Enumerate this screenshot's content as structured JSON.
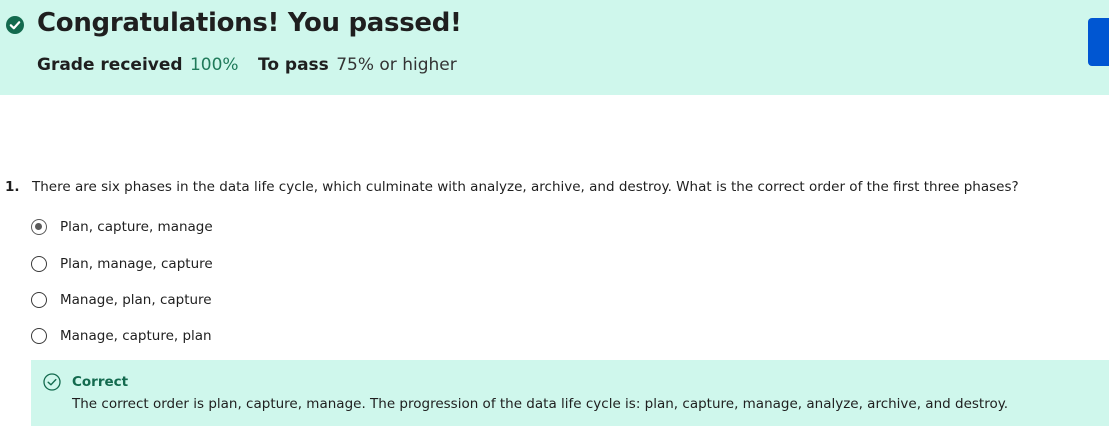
{
  "banner": {
    "title": "Congratulations! You passed!",
    "grade_label": "Grade received",
    "grade_value": "100%",
    "pass_label": "To pass",
    "pass_value": "75% or higher",
    "background_color": "#cff7ec",
    "accent_color": "#136a4e"
  },
  "question": {
    "number": "1.",
    "text": "There are six phases in the data life cycle, which culminate with analyze, archive, and destroy. What is the correct order of the first three phases?",
    "options": [
      {
        "label": "Plan, capture, manage",
        "selected": true
      },
      {
        "label": "Plan, manage, capture",
        "selected": false
      },
      {
        "label": "Manage, plan, capture",
        "selected": false
      },
      {
        "label": "Manage, capture, plan",
        "selected": false
      }
    ]
  },
  "feedback": {
    "icon": "check-circle-outline-icon",
    "title": "Correct",
    "text": "The correct order is plan, capture, manage. The progression of the data life cycle is: plan, capture, manage, analyze, archive, and destroy."
  },
  "side_button_color": "#0056d2"
}
